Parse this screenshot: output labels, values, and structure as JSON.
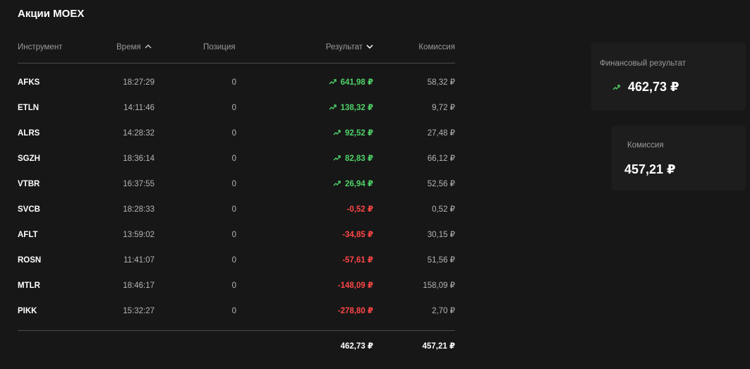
{
  "page": {
    "title": "Акции MOEX"
  },
  "columns": {
    "instrument": "Инструмент",
    "time": "Время",
    "position": "Позиция",
    "result": "Результат",
    "commission": "Комиссия"
  },
  "rows": [
    {
      "ticker": "AFKS",
      "time": "18:27:29",
      "position": "0",
      "result": "641,98 ₽",
      "trend": "up",
      "commission": "58,32 ₽"
    },
    {
      "ticker": "ETLN",
      "time": "14:11:46",
      "position": "0",
      "result": "138,32 ₽",
      "trend": "up",
      "commission": "9,72 ₽"
    },
    {
      "ticker": "ALRS",
      "time": "14:28:32",
      "position": "0",
      "result": "92,52 ₽",
      "trend": "up",
      "commission": "27,48 ₽"
    },
    {
      "ticker": "SGZH",
      "time": "18:36:14",
      "position": "0",
      "result": "82,83 ₽",
      "trend": "up",
      "commission": "66,12 ₽"
    },
    {
      "ticker": "VTBR",
      "time": "16:37:55",
      "position": "0",
      "result": "26,94 ₽",
      "trend": "up",
      "commission": "52,56 ₽"
    },
    {
      "ticker": "SVCB",
      "time": "18:28:33",
      "position": "0",
      "result": "-0,52 ₽",
      "trend": "down",
      "commission": "0,52 ₽"
    },
    {
      "ticker": "AFLT",
      "time": "13:59:02",
      "position": "0",
      "result": "-34,85 ₽",
      "trend": "down",
      "commission": "30,15 ₽"
    },
    {
      "ticker": "ROSN",
      "time": "11:41:07",
      "position": "0",
      "result": "-57,61 ₽",
      "trend": "down",
      "commission": "51,56 ₽"
    },
    {
      "ticker": "MTLR",
      "time": "18:46:17",
      "position": "0",
      "result": "-148,09 ₽",
      "trend": "down",
      "commission": "158,09 ₽"
    },
    {
      "ticker": "PIKK",
      "time": "15:32:27",
      "position": "0",
      "result": "-278,80 ₽",
      "trend": "down",
      "commission": "2,70 ₽"
    }
  ],
  "totals": {
    "result": "462,73 ₽",
    "commission": "457,21 ₽"
  },
  "summary": {
    "financial_result_label": "Финансовый результат",
    "financial_result_value": "462,73 ₽",
    "commission_label": "Комиссия",
    "commission_value": "457,21 ₽"
  },
  "colors": {
    "positive": "#4fd168",
    "negative": "#ff4646",
    "background": "#171717"
  },
  "icons": {
    "trend_up": "trend-up-icon",
    "sort_asc": "chevron-up-icon",
    "sort_desc": "chevron-down-icon"
  }
}
